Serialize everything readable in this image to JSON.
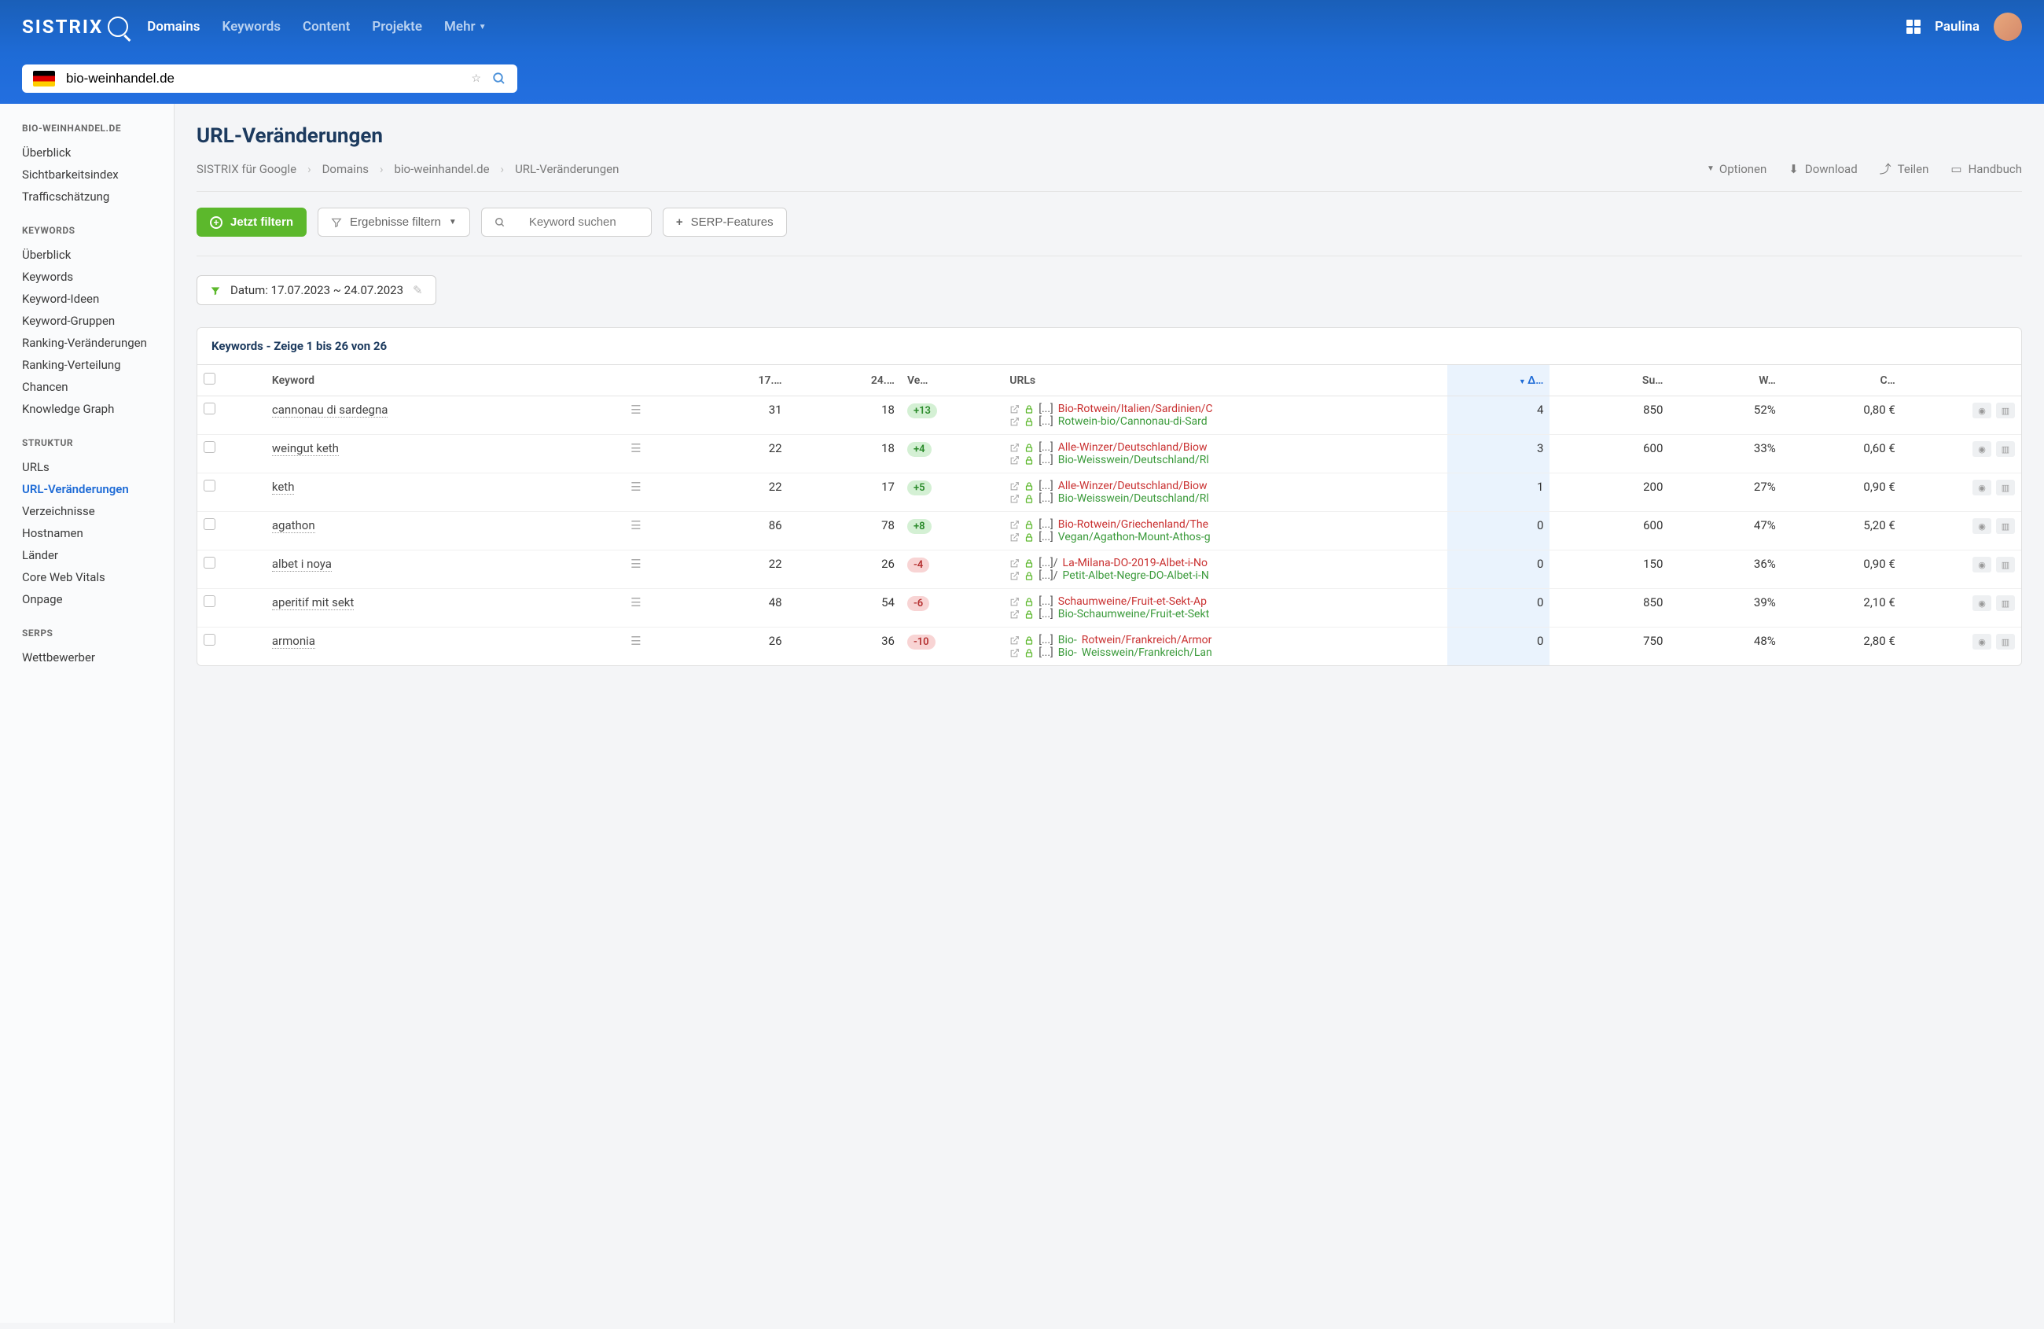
{
  "brand": "SISTRIX",
  "nav": {
    "items": [
      "Domains",
      "Keywords",
      "Content",
      "Projekte",
      "Mehr"
    ],
    "active": 0
  },
  "user": {
    "name": "Paulina"
  },
  "search": {
    "value": "bio-weinhandel.de"
  },
  "sidebar": {
    "s0": {
      "title": "BIO-WEINHANDEL.DE",
      "items": [
        "Überblick",
        "Sichtbarkeitsindex",
        "Trafficschätzung"
      ]
    },
    "s1": {
      "title": "KEYWORDS",
      "items": [
        "Überblick",
        "Keywords",
        "Keyword-Ideen",
        "Keyword-Gruppen",
        "Ranking-Veränderungen",
        "Ranking-Verteilung",
        "Chancen",
        "Knowledge Graph"
      ]
    },
    "s2": {
      "title": "STRUKTUR",
      "items": [
        "URLs",
        "URL-Veränderungen",
        "Verzeichnisse",
        "Hostnamen",
        "Länder",
        "Core Web Vitals",
        "Onpage"
      ],
      "active": 1
    },
    "s3": {
      "title": "SERPS",
      "items": [
        "Wettbewerber"
      ]
    }
  },
  "page": {
    "title": "URL-Veränderungen",
    "crumbs": [
      "SISTRIX für Google",
      "Domains",
      "bio-weinhandel.de",
      "URL-Veränderungen"
    ],
    "actions": {
      "options": "Optionen",
      "download": "Download",
      "share": "Teilen",
      "handbook": "Handbuch"
    }
  },
  "toolbar": {
    "filter_now": "Jetzt filtern",
    "filter_results": "Ergebnisse filtern",
    "search_placeholder": "Keyword suchen",
    "serp_features": "SERP-Features"
  },
  "date_chip": "Datum: 17.07.2023 ~ 24.07.2023",
  "table": {
    "title": "Keywords - Zeige 1 bis 26 von 26",
    "cols": {
      "kw": "Keyword",
      "d1": "17.…",
      "d2": "24.…",
      "chg": "Ve…",
      "urls": "URLs",
      "delta": "Δ…",
      "sv": "Su…",
      "comp": "W…",
      "cpc": "C…"
    },
    "url_prefix": "[...]",
    "rows": [
      {
        "kw": "cannonau di sardegna",
        "d1": "31",
        "d2": "18",
        "chg": "+13",
        "chg_dir": "pos",
        "delta": "4",
        "sv": "850",
        "comp": "52%",
        "cpc": "0,80 €",
        "url_old": "Bio-Rotwein/Italien/Sardinien/C",
        "url_new": "Rotwein-bio/Cannonau-di-Sard"
      },
      {
        "kw": "weingut keth",
        "d1": "22",
        "d2": "18",
        "chg": "+4",
        "chg_dir": "pos",
        "delta": "3",
        "sv": "600",
        "comp": "33%",
        "cpc": "0,60 €",
        "url_old": "Alle-Winzer/Deutschland/Biow",
        "url_new": "Bio-Weisswein/Deutschland/Rl"
      },
      {
        "kw": "keth",
        "d1": "22",
        "d2": "17",
        "chg": "+5",
        "chg_dir": "pos",
        "delta": "1",
        "sv": "200",
        "comp": "27%",
        "cpc": "0,90 €",
        "url_old": "Alle-Winzer/Deutschland/Biow",
        "url_new": "Bio-Weisswein/Deutschland/Rl"
      },
      {
        "kw": "agathon",
        "d1": "86",
        "d2": "78",
        "chg": "+8",
        "chg_dir": "pos",
        "delta": "0",
        "sv": "600",
        "comp": "47%",
        "cpc": "5,20 €",
        "url_old": "Bio-Rotwein/Griechenland/The",
        "url_new": "Vegan/Agathon-Mount-Athos-g"
      },
      {
        "kw": "albet i noya",
        "d1": "22",
        "d2": "26",
        "chg": "-4",
        "chg_dir": "neg",
        "delta": "0",
        "sv": "150",
        "comp": "36%",
        "cpc": "0,90 €",
        "url_old_prefix": "[...]/",
        "url_old": "La-Milana-DO-2019-Albet-i-No",
        "url_new_prefix": "[...]/",
        "url_new": "Petit-Albet-Negre-DO-Albet-i-N"
      },
      {
        "kw": "aperitif mit sekt",
        "d1": "48",
        "d2": "54",
        "chg": "-6",
        "chg_dir": "neg",
        "delta": "0",
        "sv": "850",
        "comp": "39%",
        "cpc": "2,10 €",
        "url_old": "Schaumweine/Fruit-et-Sekt-Ap",
        "url_new": "Bio-Schaumweine/Fruit-et-Sekt"
      },
      {
        "kw": "armonia",
        "d1": "26",
        "d2": "36",
        "chg": "-10",
        "chg_dir": "neg",
        "delta": "0",
        "sv": "750",
        "comp": "48%",
        "cpc": "2,80 €",
        "url_old_pre": "Bio-",
        "url_old_red": "Rotwein/Frankreich/Armor",
        "url_new_pre": "Bio-",
        "url_new_green": "Weisswein/Frankreich/Lan"
      }
    ]
  }
}
